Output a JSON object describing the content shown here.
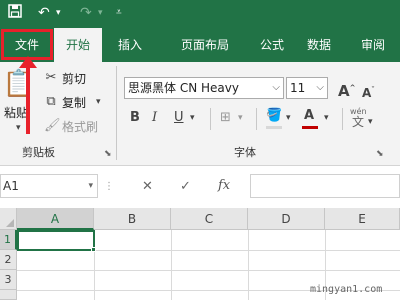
{
  "colors": {
    "excel_green": "#217346",
    "highlight_red": "#e8212b",
    "font_color_swatch": "#c00000"
  },
  "quick_access": {
    "save_icon": "save-icon",
    "undo_icon": "undo-icon",
    "redo_icon": "redo-icon",
    "customize_icon": "customize-qat-icon"
  },
  "tabs": [
    {
      "label": "文件"
    },
    {
      "label": "开始"
    },
    {
      "label": "插入"
    },
    {
      "label": "页面布局"
    },
    {
      "label": "公式"
    },
    {
      "label": "数据"
    },
    {
      "label": "审阅"
    }
  ],
  "ribbon": {
    "clipboard": {
      "paste_label": "粘贴",
      "cut_label": "剪切",
      "copy_label": "复制",
      "format_painter_label": "格式刷",
      "group_label": "剪贴板"
    },
    "font": {
      "font_name": "思源黑体 CN Heavy",
      "font_size": "11",
      "bold": "B",
      "italic": "I",
      "underline": "U",
      "grow_font": "A",
      "shrink_font": "A",
      "font_color": "A",
      "phonetic_label": "wén",
      "phonetic_char": "文",
      "group_label": "字体"
    }
  },
  "formula_bar": {
    "name_box": "A1",
    "cancel_symbol": "✕",
    "enter_symbol": "✓",
    "fx_label": "fx",
    "formula_value": ""
  },
  "sheet": {
    "columns": [
      "A",
      "B",
      "C",
      "D",
      "E"
    ],
    "rows": [
      "1",
      "2",
      "3"
    ],
    "active_cell": "A1"
  },
  "watermark": "mingyan1.com"
}
